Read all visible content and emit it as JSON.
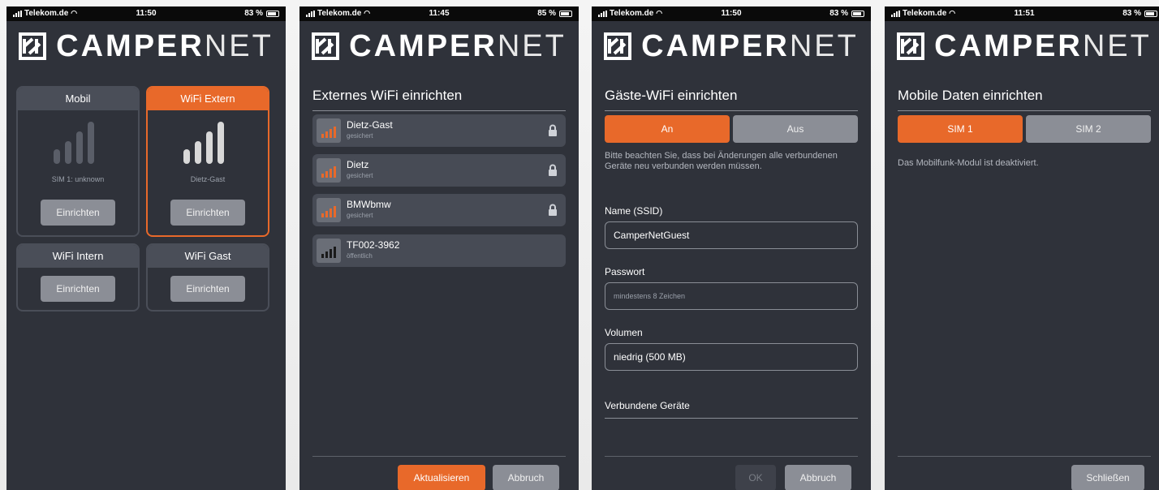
{
  "status": [
    {
      "carrier": "Telekom.de",
      "time": "11:50",
      "battery": "83 %"
    },
    {
      "carrier": "Telekom.de",
      "time": "11:45",
      "battery": "85 %"
    },
    {
      "carrier": "Telekom.de",
      "time": "11:50",
      "battery": "83 %"
    },
    {
      "carrier": "Telekom.de",
      "time": "11:51",
      "battery": "83 %"
    }
  ],
  "brand": {
    "bold": "CAMPER",
    "thin": "NET"
  },
  "screen1": {
    "tiles": [
      {
        "title": "Mobil",
        "sub": "SIM 1: unknown",
        "button": "Einrichten",
        "active": false
      },
      {
        "title": "WiFi Extern",
        "sub": "Dietz-Gast",
        "button": "Einrichten",
        "active": true
      },
      {
        "title": "WiFi Intern",
        "button": "Einrichten",
        "active": false
      },
      {
        "title": "WiFi Gast",
        "button": "Einrichten",
        "active": false
      }
    ]
  },
  "screen2": {
    "heading": "Externes WiFi einrichten",
    "networks": [
      {
        "name": "Dietz-Gast",
        "status": "gesichert",
        "secured": true,
        "color": "#e8692a"
      },
      {
        "name": "Dietz",
        "status": "gesichert",
        "secured": true,
        "color": "#e8692a"
      },
      {
        "name": "BMWbmw",
        "status": "gesichert",
        "secured": true,
        "color": "#e8692a"
      },
      {
        "name": "TF002-3962",
        "status": "öffentlich",
        "secured": false,
        "color": "#1a1a1a"
      }
    ],
    "refresh": "Aktualisieren",
    "cancel": "Abbruch"
  },
  "screen3": {
    "heading": "Gäste-WiFi einrichten",
    "on": "An",
    "off": "Aus",
    "note": "Bitte beachten Sie, dass bei Änderungen alle verbundenen Geräte neu verbunden werden müssen.",
    "ssid_label": "Name (SSID)",
    "ssid_value": "CamperNetGuest",
    "password_label": "Passwort",
    "password_placeholder": "mindestens 8 Zeichen",
    "volume_label": "Volumen",
    "volume_value": "niedrig (500 MB)",
    "devices_label": "Verbundene Geräte",
    "ok": "OK",
    "cancel": "Abbruch"
  },
  "screen4": {
    "heading": "Mobile Daten einrichten",
    "sim1": "SIM 1",
    "sim2": "SIM 2",
    "note": "Das Mobilfunk-Modul ist deaktiviert.",
    "close": "Schließen"
  },
  "colors": {
    "accent": "#e8692a",
    "background": "#2f323a",
    "button_gray": "#8b8e96"
  }
}
